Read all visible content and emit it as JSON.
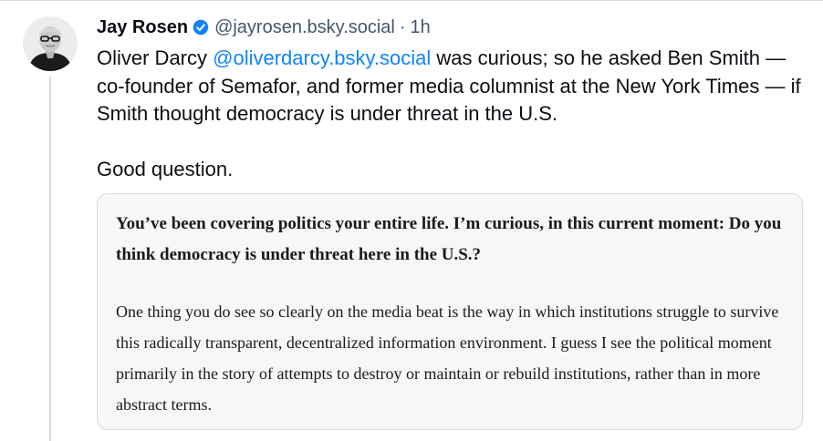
{
  "post": {
    "author_name": "Jay Rosen",
    "author_handle": "@jayrosen.bsky.social",
    "separator": "·",
    "time": "1h",
    "verified_icon": "verified-badge-icon",
    "text_before_mention": "Oliver Darcy ",
    "mention": "@oliverdarcy.bsky.social",
    "text_after_mention": " was curious; so he asked Ben Smith — co-founder of Semafor, and former media columnist at the New York Times — if Smith thought democracy is under threat in the U.S.",
    "second_paragraph": "Good question."
  },
  "quote_image": {
    "question": "You’ve been covering politics your entire life. I’m curious, in this current moment: Do you think democracy is under threat here in the U.S.?",
    "answer": "One thing you do see so clearly on the media beat is the way in which institutions struggle to survive this radically transparent, decentralized information environment. I guess I see the political moment primarily in the story of attempts to destroy or maintain or rebuild institutions, rather than in more abstract terms."
  },
  "colors": {
    "mention": "#1083fe",
    "verified": "#1083fe",
    "muted_text": "#42576c",
    "border": "#d4dbe2"
  }
}
